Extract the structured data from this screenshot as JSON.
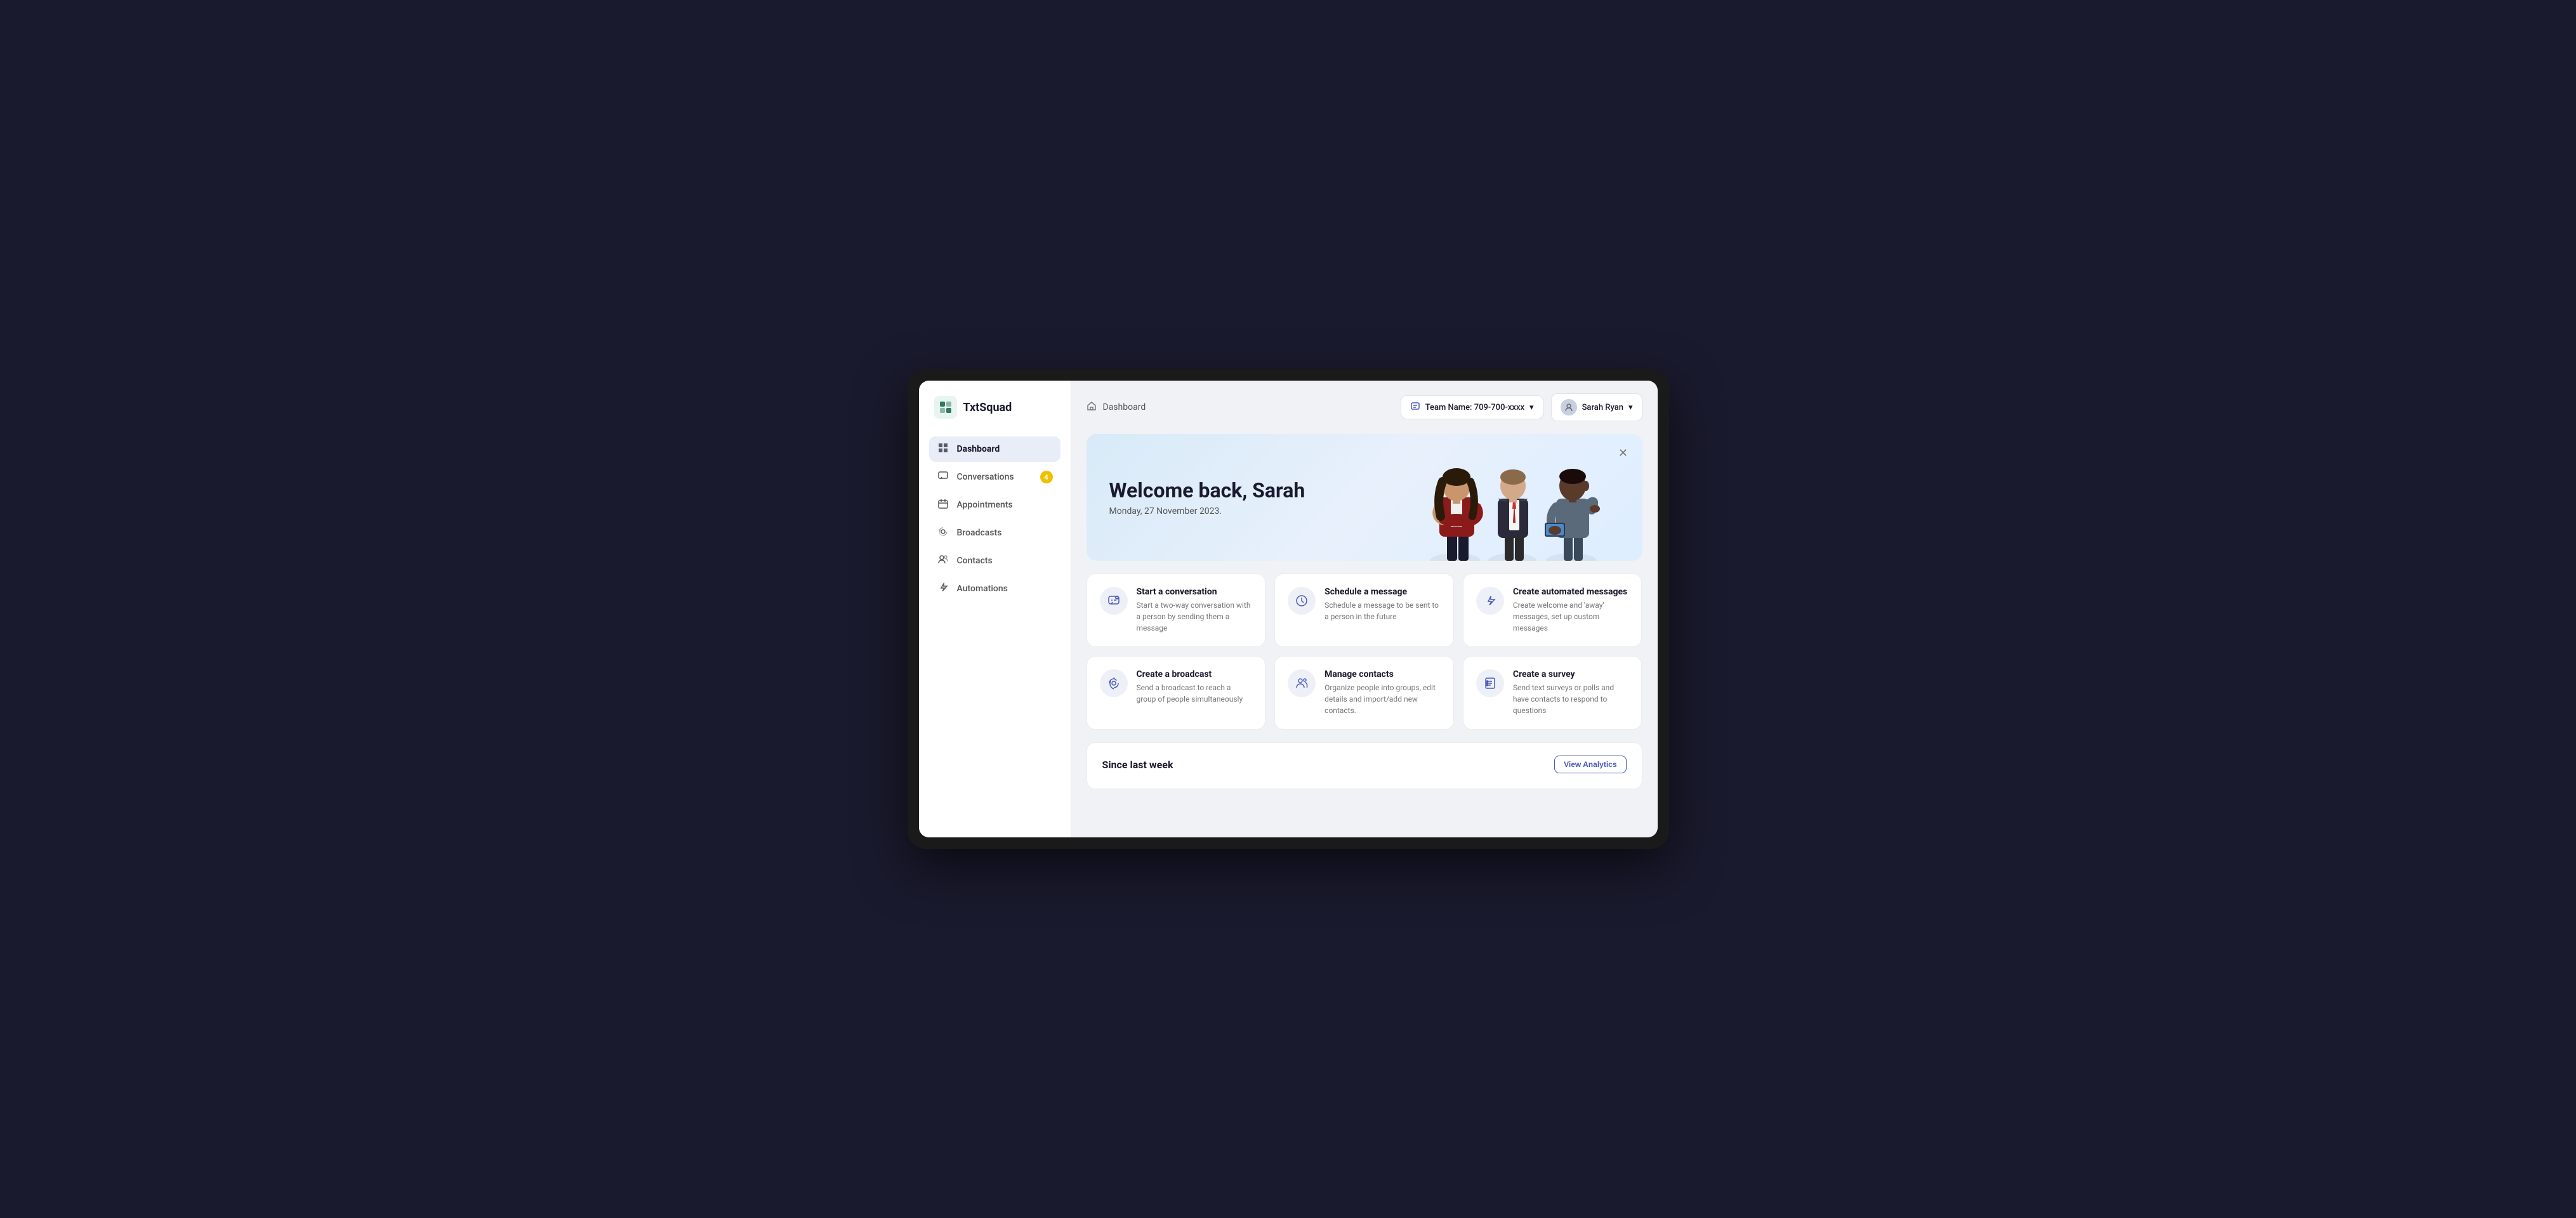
{
  "app": {
    "name": "TxtSquad"
  },
  "header": {
    "page_title": "Dashboard",
    "team_label": "Team Name: 709-700-xxxx",
    "user_name": "Sarah Ryan"
  },
  "sidebar": {
    "items": [
      {
        "id": "dashboard",
        "label": "Dashboard",
        "icon": "⊞",
        "active": true,
        "badge": null
      },
      {
        "id": "conversations",
        "label": "Conversations",
        "icon": "💬",
        "active": false,
        "badge": "4"
      },
      {
        "id": "appointments",
        "label": "Appointments",
        "icon": "📅",
        "active": false,
        "badge": null
      },
      {
        "id": "broadcasts",
        "label": "Broadcasts",
        "icon": "📣",
        "active": false,
        "badge": null
      },
      {
        "id": "contacts",
        "label": "Contacts",
        "icon": "👥",
        "active": false,
        "badge": null
      },
      {
        "id": "automations",
        "label": "Automations",
        "icon": "⚡",
        "active": false,
        "badge": null
      }
    ]
  },
  "welcome_banner": {
    "greeting": "Welcome back, Sarah",
    "date": "Monday, 27 November 2023."
  },
  "action_cards": [
    {
      "id": "start-conversation",
      "title": "Start a conversation",
      "description": "Start a two-way conversation with a person by sending them a message",
      "icon": "💬"
    },
    {
      "id": "schedule-message",
      "title": "Schedule a message",
      "description": "Schedule a message to be sent to a person in the future",
      "icon": "🕐"
    },
    {
      "id": "create-automated",
      "title": "Create automated messages",
      "description": "Create welcome and 'away' messages, set up custom messages",
      "icon": "⚡"
    },
    {
      "id": "create-broadcast",
      "title": "Create a broadcast",
      "description": "Send a broadcast to reach a group of people simultaneously",
      "icon": "📣"
    },
    {
      "id": "manage-contacts",
      "title": "Manage contacts",
      "description": "Organize people into groups, edit details and import/add new contacts.",
      "icon": "👥"
    },
    {
      "id": "create-survey",
      "title": "Create a survey",
      "description": "Send text surveys or polls and have contacts to respond to questions",
      "icon": "📋"
    }
  ],
  "since_section": {
    "title": "Since last week",
    "view_analytics_label": "View Analytics"
  },
  "colors": {
    "accent": "#4a5abb",
    "badge_bg": "#f0c000",
    "active_nav_bg": "#e8edf8",
    "card_icon_bg": "#eef0f8",
    "banner_bg_start": "#d8eaf8",
    "banner_bg_end": "#ddeeff"
  }
}
